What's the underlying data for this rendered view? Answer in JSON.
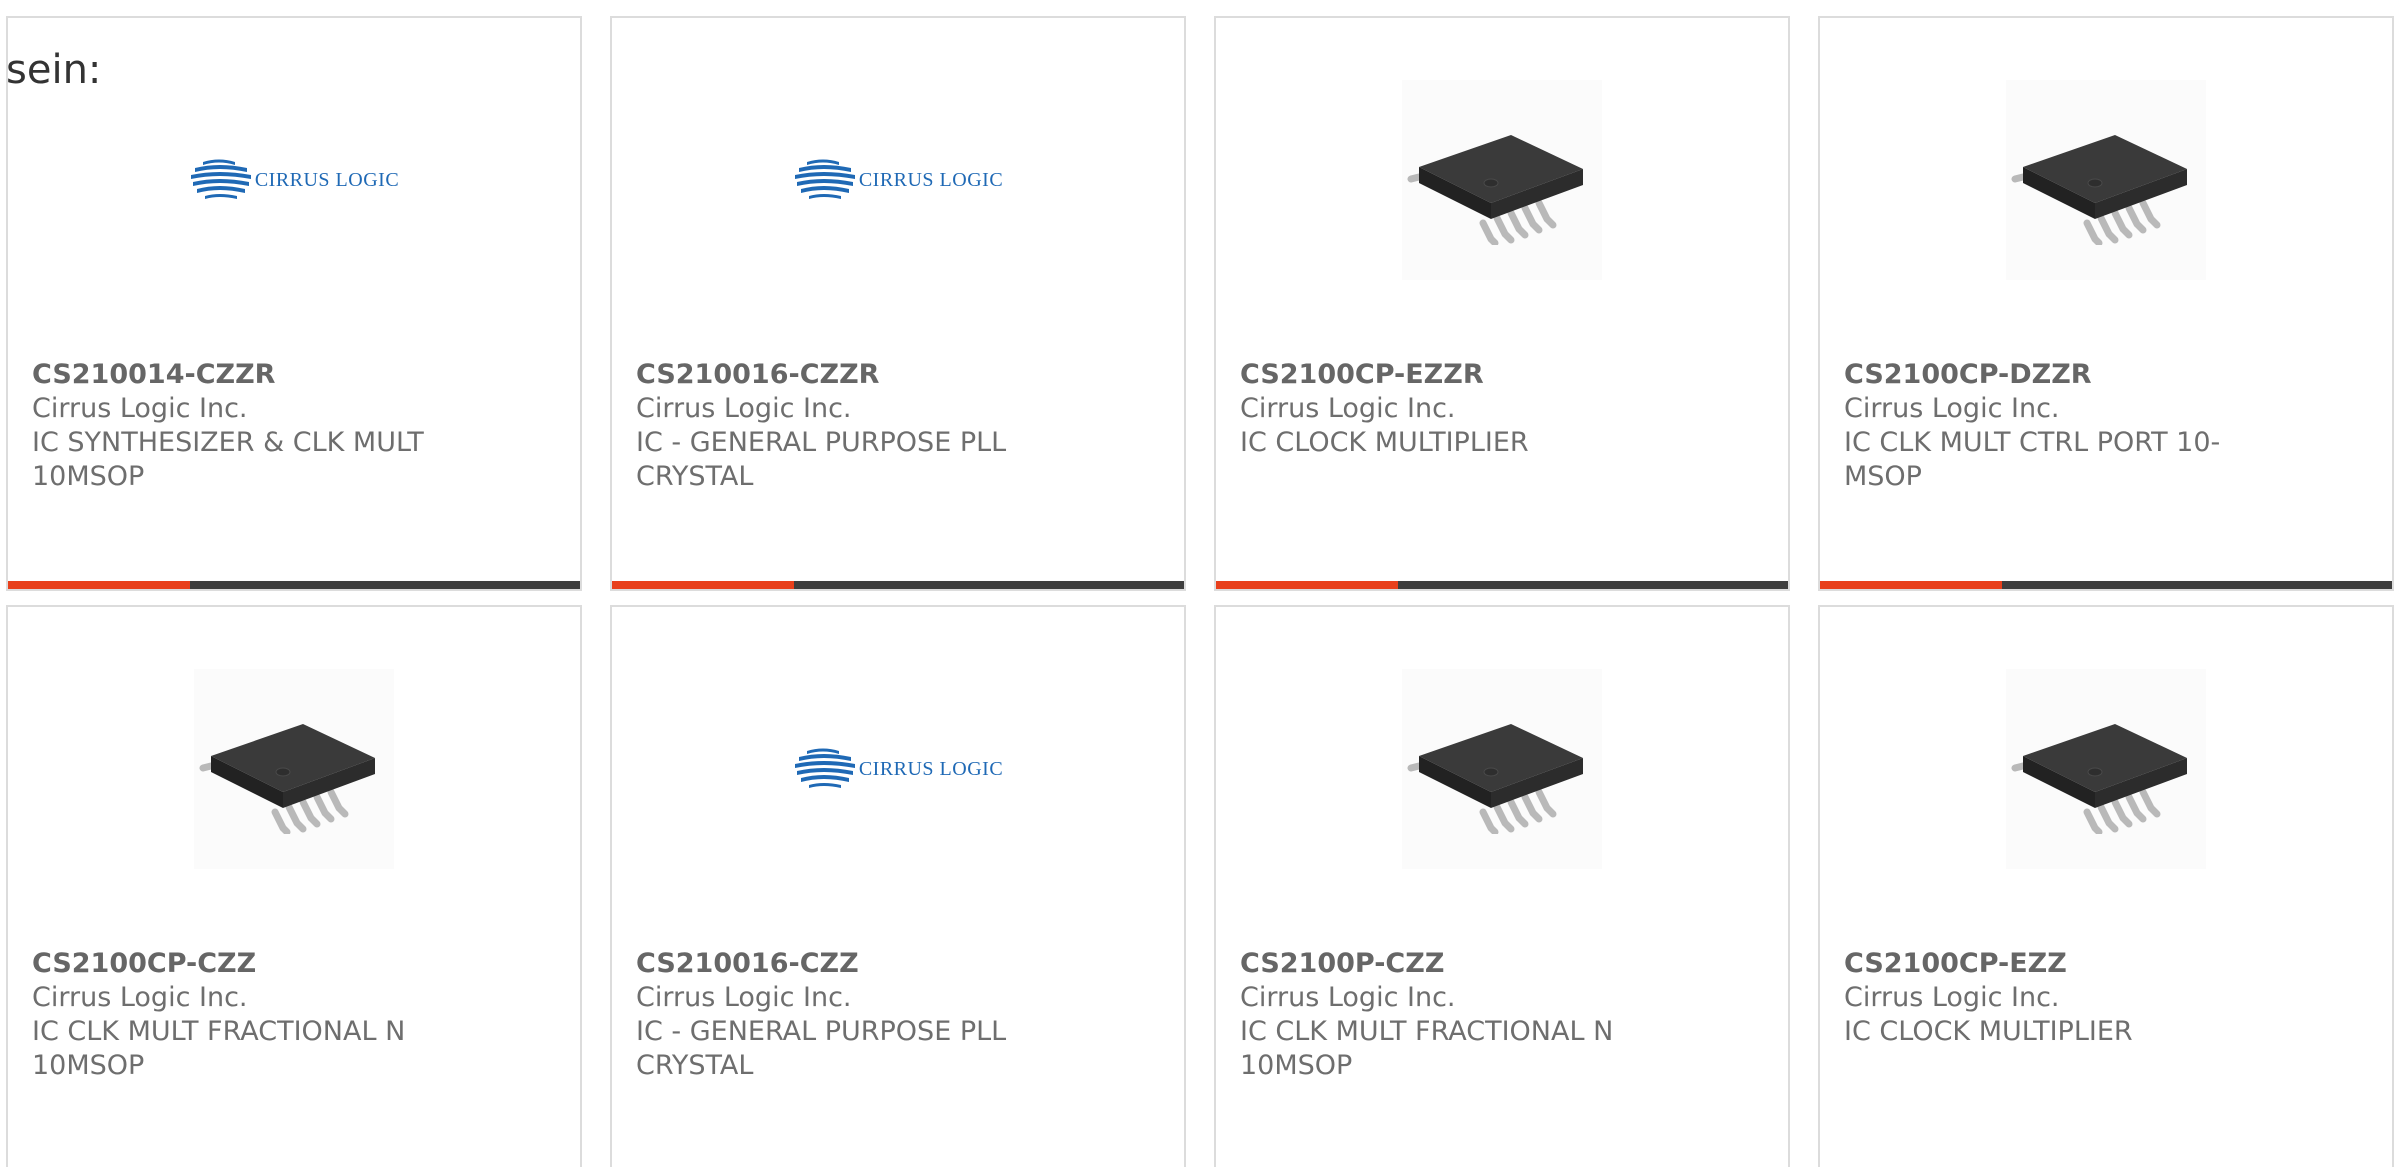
{
  "intro": {
    "text": "sein:"
  },
  "colors": {
    "accent": "#e8401c",
    "bar_dark": "#3e3e3e",
    "logo_blue": "#1f69b5"
  },
  "cards": [
    {
      "part_number": "CS210014-CZZR",
      "manufacturer": "Cirrus Logic Inc.",
      "description": "IC SYNTHESIZER & CLK MULT 10MSOP",
      "image": "cirrus-logic-logo",
      "logo_text": "CIRRUS LOGIC"
    },
    {
      "part_number": "CS210016-CZZR",
      "manufacturer": "Cirrus Logic Inc.",
      "description": "IC - GENERAL PURPOSE PLL CRYSTAL",
      "image": "cirrus-logic-logo",
      "logo_text": "CIRRUS LOGIC"
    },
    {
      "part_number": "CS2100CP-EZZR",
      "manufacturer": "Cirrus Logic Inc.",
      "description": "IC CLOCK MULTIPLIER",
      "image": "msop-chip-photo"
    },
    {
      "part_number": "CS2100CP-DZZR",
      "manufacturer": "Cirrus Logic Inc.",
      "description": "IC CLK MULT CTRL PORT 10-MSOP",
      "image": "msop-chip-photo"
    },
    {
      "part_number": "CS2100CP-CZZ",
      "manufacturer": "Cirrus Logic Inc.",
      "description": "IC CLK MULT FRACTIONAL N 10MSOP",
      "image": "msop-chip-photo"
    },
    {
      "part_number": "CS210016-CZZ",
      "manufacturer": "Cirrus Logic Inc.",
      "description": "IC - GENERAL PURPOSE PLL CRYSTAL",
      "image": "cirrus-logic-logo",
      "logo_text": "CIRRUS LOGIC"
    },
    {
      "part_number": "CS2100P-CZZ",
      "manufacturer": "Cirrus Logic Inc.",
      "description": "IC CLK MULT FRACTIONAL N 10MSOP",
      "image": "msop-chip-photo"
    },
    {
      "part_number": "CS2100CP-EZZ",
      "manufacturer": "Cirrus Logic Inc.",
      "description": "IC CLOCK MULTIPLIER",
      "image": "msop-chip-photo"
    }
  ]
}
